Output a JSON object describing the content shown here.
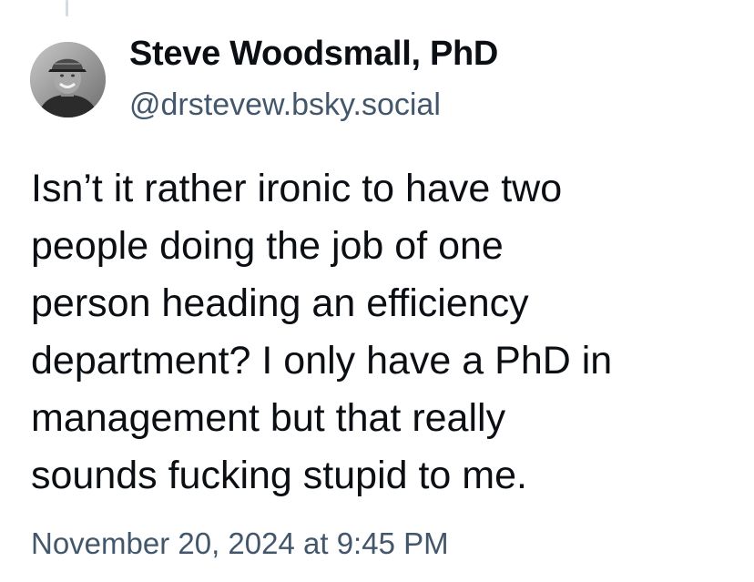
{
  "author": {
    "display_name": "Steve Woodsmall, PhD",
    "handle": "@drstevew.bsky.social"
  },
  "post": {
    "text": "Isn’t it rather ironic to have two\npeople doing the job of one\nperson heading an efficiency\ndepartment? I only have a PhD in\nmanagement but that really\nsounds fucking stupid to me.",
    "timestamp": "November 20, 2024 at 9:45 PM"
  },
  "colors": {
    "text": "#0b0f14",
    "secondary_text": "#42576c",
    "thread_line": "#d4dbe2"
  }
}
